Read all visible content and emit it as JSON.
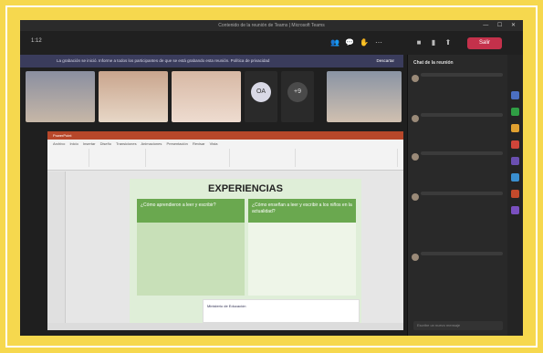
{
  "window": {
    "title": "Contenido de la reunión de Teams | Microsoft Teams",
    "controls": "— ☐ ✕"
  },
  "topbar": {
    "timer": "1:12",
    "leave_label": "Salir"
  },
  "banner": {
    "text": "La grabación se inició. Informe a todos los participantes de que se está grabando esta reunión. Política de privacidad",
    "dismiss": "Descartar"
  },
  "participants": [
    {
      "name": ""
    },
    {
      "name": ""
    },
    {
      "name": ""
    },
    {
      "initials": "OA",
      "name": ""
    },
    {
      "initials": "+9",
      "name": ""
    },
    {
      "name": ""
    }
  ],
  "presentation": {
    "app_bar": "PowerPoint",
    "ribbon_tabs": "Archivo Inicio Insertar Diseño Transiciones Animaciones Presentación Revisar Vista",
    "slide_title": "EXPERIENCIAS",
    "col1_header": "¿Cómo aprendieron a leer y escribir?",
    "col2_header": "¿Cómo enseñan a leer y escribir a los niños en la actualidad?",
    "footer": "Ministerio de Educación"
  },
  "chat": {
    "title": "Chat de la reunión",
    "messages": [
      {
        "author": "",
        "text": ""
      },
      {
        "author": "",
        "text": ""
      },
      {
        "author": "",
        "text": ""
      },
      {
        "author": "",
        "text": ""
      },
      {
        "author": "",
        "text": ""
      }
    ],
    "reply_placeholder": "Escribe un nuevo mensaje"
  },
  "colors": {
    "frame": "#f6d84e",
    "teams_dark": "#1f1f1f",
    "hangup": "#c4314b",
    "ppt": "#b7472a",
    "slide_green": "#6aa84f"
  }
}
